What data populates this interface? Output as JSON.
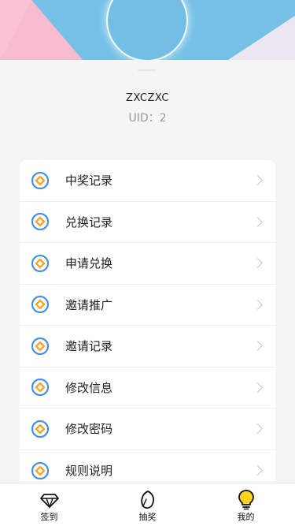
{
  "profile": {
    "username": "ZXCZXC",
    "uid_label": "UID：",
    "uid_value": "2"
  },
  "menu": {
    "items": [
      {
        "label": "中奖记录",
        "icon": "diamond-circle-icon"
      },
      {
        "label": "兑换记录",
        "icon": "diamond-circle-icon"
      },
      {
        "label": "申请兑换",
        "icon": "diamond-circle-icon"
      },
      {
        "label": "邀请推广",
        "icon": "diamond-circle-icon"
      },
      {
        "label": "邀请记录",
        "icon": "diamond-circle-icon"
      },
      {
        "label": "修改信息",
        "icon": "diamond-circle-icon"
      },
      {
        "label": "修改密码",
        "icon": "diamond-circle-icon"
      },
      {
        "label": "规则说明",
        "icon": "diamond-circle-icon"
      }
    ]
  },
  "tabbar": {
    "tabs": [
      {
        "label": "签到",
        "icon": "diamond-gem-icon"
      },
      {
        "label": "抽奖",
        "icon": "leaf-icon"
      },
      {
        "label": "我的",
        "icon": "lightbulb-icon"
      }
    ]
  },
  "colors": {
    "banner_blue": "#74c0e6",
    "banner_pink": "#f9c3d2",
    "icon_blue": "#4a90e2",
    "icon_orange": "#f5a623",
    "active_yellow": "#ffd21f",
    "page_background": "#f5f5f5"
  }
}
